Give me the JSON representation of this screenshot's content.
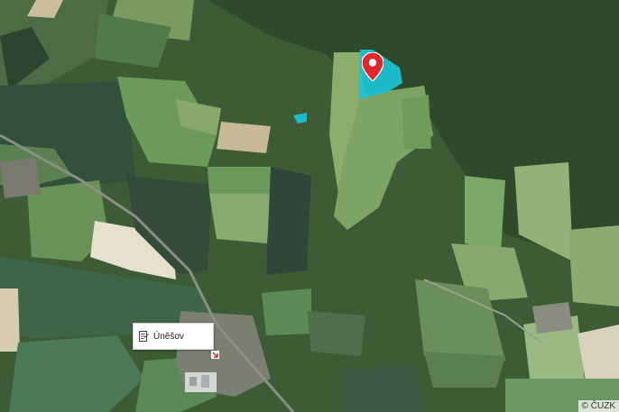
{
  "map": {
    "type": "aerial-orthophoto",
    "place_label": "Úněšov",
    "attribution": "© ČUZK",
    "marker_color": "#e0262a",
    "highlight_color": "#19c3d6",
    "icons": [
      "location-pin-icon",
      "document-icon",
      "town-marker-icon"
    ]
  }
}
